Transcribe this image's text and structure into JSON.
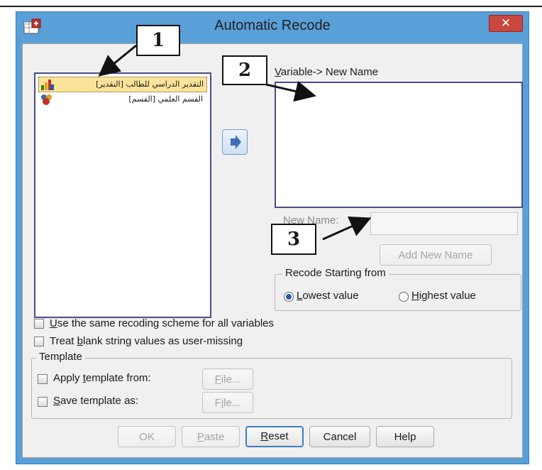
{
  "window": {
    "title": "Automatic Recode",
    "close_label": "✕",
    "app_icon": "spss-recode-icon"
  },
  "source_list": {
    "items": [
      {
        "label": "التقدير الدراسي للطالب [التقدير]",
        "icon": "ordinal-variable-icon",
        "selected": true
      },
      {
        "label": "القسم العلمي [القسم]",
        "icon": "nominal-variable-icon",
        "selected": false
      }
    ]
  },
  "move_button": {
    "icon": "arrow-right-icon"
  },
  "target": {
    "label_prefix": "",
    "label_key": "V",
    "label_rest": "ariable-> New Name"
  },
  "new_name": {
    "label_key": "N",
    "label_rest": "ew Name:",
    "value": ""
  },
  "add_new_name": {
    "label": "Add New Name"
  },
  "recode_group": {
    "legend": "Recode Starting from",
    "options": [
      {
        "key": "L",
        "rest": "owest value",
        "selected": true
      },
      {
        "key": "H",
        "rest": "ighest value",
        "selected": false
      }
    ]
  },
  "checkboxes": [
    {
      "key": "U",
      "before": "",
      "rest": "se the same recoding scheme for all variables",
      "checked": false
    },
    {
      "key": "b",
      "before": "Treat ",
      "rest": "lank string values as user-missing",
      "checked": false
    }
  ],
  "template_group": {
    "legend": "Template",
    "apply": {
      "before": "Apply ",
      "key": "t",
      "rest": "emplate from:",
      "checked": false
    },
    "save": {
      "before": "",
      "key": "S",
      "rest": "ave template as:",
      "checked": false
    },
    "file1": {
      "before": "",
      "key": "F",
      "rest": "ile..."
    },
    "file2": {
      "before": "F",
      "key": "i",
      "rest": "le..."
    }
  },
  "buttons": {
    "ok": "OK",
    "paste_key": "P",
    "paste_rest": "aste",
    "reset_key": "R",
    "reset_rest": "eset",
    "cancel": "Cancel",
    "help": "Help"
  },
  "callouts": [
    "1",
    "2",
    "3"
  ],
  "colors": {
    "title_bar": "#5aa0d8",
    "close": "#c9473c",
    "selected_item": "#fbe49a",
    "list_border": "#4b4c8a"
  }
}
